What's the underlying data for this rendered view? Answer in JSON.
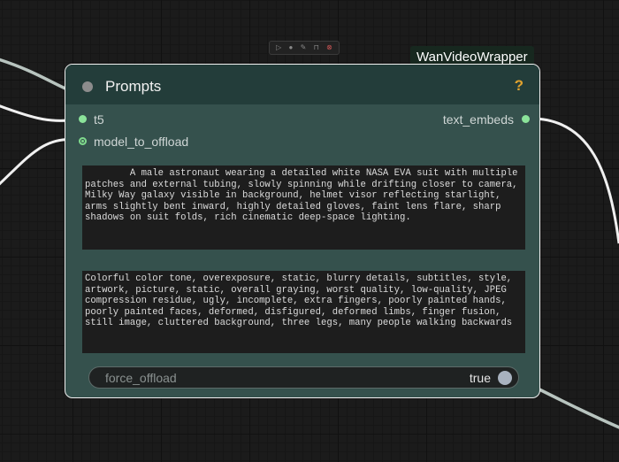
{
  "node": {
    "title": "Prompts",
    "package_badge": "WanVideoWrapper",
    "help_symbol": "?",
    "inputs": [
      {
        "label": "t5"
      },
      {
        "label": "model_to_offload"
      }
    ],
    "outputs": [
      {
        "label": "text_embeds"
      }
    ],
    "positive_prompt": "        A male astronaut wearing a detailed white NASA EVA suit with multiple patches and external tubing, slowly spinning while drifting closer to camera, Milky Way galaxy visible in background, helmet visor reflecting starlight, arms slightly bent inward, highly detailed gloves, faint lens flare, sharp shadows on suit folds, rich cinematic deep-space lighting.",
    "negative_prompt": "Colorful color tone, overexposure, static, blurry details, subtitles, style, artwork, picture, static, overall graying, worst quality, low-quality, JPEG compression residue, ugly, incomplete, extra fingers, poorly painted hands, poorly painted faces, deformed, disfigured, deformed limbs, finger fusion, still image, cluttered background, three legs, many people walking backwards",
    "force_offload": {
      "label": "force_offload",
      "value": "true"
    }
  },
  "toolbar_icons": [
    "play-icon",
    "bypass-icon",
    "pin-icon",
    "delete-icon"
  ],
  "colors": {
    "node_body": "#35514d",
    "node_header": "#233d3a",
    "slot_green": "#8be39a",
    "help_orange": "#e0a22e"
  }
}
